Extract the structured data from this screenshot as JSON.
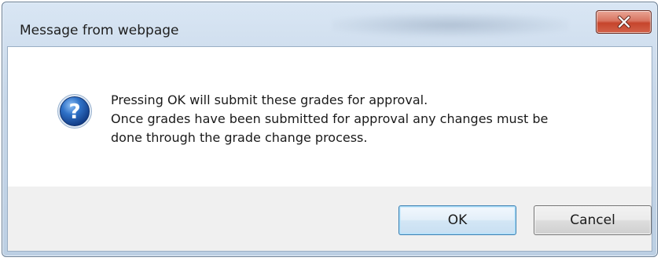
{
  "dialog": {
    "title": "Message from webpage",
    "close_icon": "close-icon",
    "message_icon": "question-icon",
    "message_lines": [
      "Pressing OK will submit these grades for approval.",
      "Once grades have been submitted for approval any changes must be",
      "done through the grade change process."
    ],
    "buttons": {
      "ok_label": "OK",
      "cancel_label": "Cancel"
    }
  },
  "colors": {
    "close_button": "#c6452c",
    "icon_blue": "#1f5fb3",
    "default_button_border": "#3c7fb1",
    "footer_background": "#f0f0f0"
  }
}
